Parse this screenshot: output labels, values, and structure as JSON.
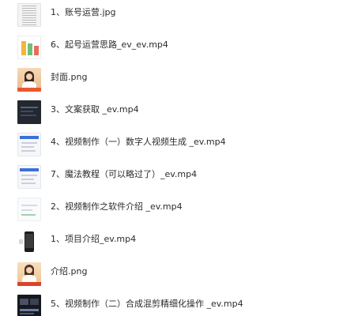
{
  "files": [
    {
      "name": "1、账号运营.jpg",
      "thumbnail": "document-image"
    },
    {
      "name": "6、起号运营思路_ev_ev.mp4",
      "thumbnail": "slide-video"
    },
    {
      "name": "封面.png",
      "thumbnail": "cover-image"
    },
    {
      "name": "3、文案获取 _ev.mp4",
      "thumbnail": "dark-screen-video"
    },
    {
      "name": "4、视频制作（一）数字人视频生成 _ev.mp4",
      "thumbnail": "screen-video"
    },
    {
      "name": "7、魔法教程（可以略过了）_ev.mp4",
      "thumbnail": "screen-video"
    },
    {
      "name": "2、视频制作之软件介绍 _ev.mp4",
      "thumbnail": "light-screen-video"
    },
    {
      "name": "1、项目介绍_ev.mp4",
      "thumbnail": "phone-video"
    },
    {
      "name": "介绍.png",
      "thumbnail": "cover-image"
    },
    {
      "name": "5、视频制作（二）合成混剪精细化操作 _ev.mp4",
      "thumbnail": "dark-editor-video"
    }
  ]
}
